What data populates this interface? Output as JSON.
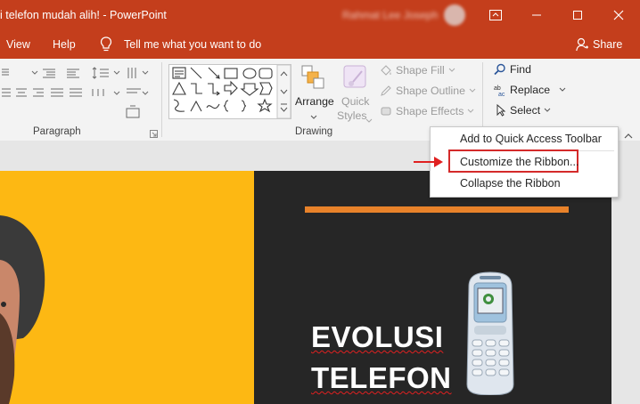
{
  "window": {
    "title": "i telefon mudah alih!  -  PowerPoint",
    "user_name": "Rahmat Lee Joseph"
  },
  "menu": {
    "tabs": [
      {
        "label": "View"
      },
      {
        "label": "Help"
      }
    ],
    "tell_me": "Tell me what you want to do",
    "share_label": "Share"
  },
  "ribbon": {
    "paragraph_label": "Paragraph",
    "drawing_label": "Drawing",
    "arrange_label": "Arrange",
    "quick_styles_line1": "Quick",
    "quick_styles_line2": "Styles",
    "shape_fill": "Shape Fill",
    "shape_outline": "Shape Outline",
    "shape_effects": "Shape Effects",
    "find": "Find",
    "replace": "Replace",
    "select": "Select"
  },
  "context_menu": {
    "items": [
      {
        "label": "Add to Quick Access Toolbar"
      },
      {
        "label": "Customize the Ribbon..."
      },
      {
        "label": "Collapse the Ribbon"
      }
    ]
  },
  "slide": {
    "title_line1": "EVOLUSI",
    "title_line2": "TELEFON"
  },
  "colors": {
    "title_bar": "#c43e1c",
    "slide_yellow": "#fdb813",
    "slide_dark": "#262626",
    "accent_orange": "#e8822a",
    "highlight_red": "#d42a2a"
  }
}
